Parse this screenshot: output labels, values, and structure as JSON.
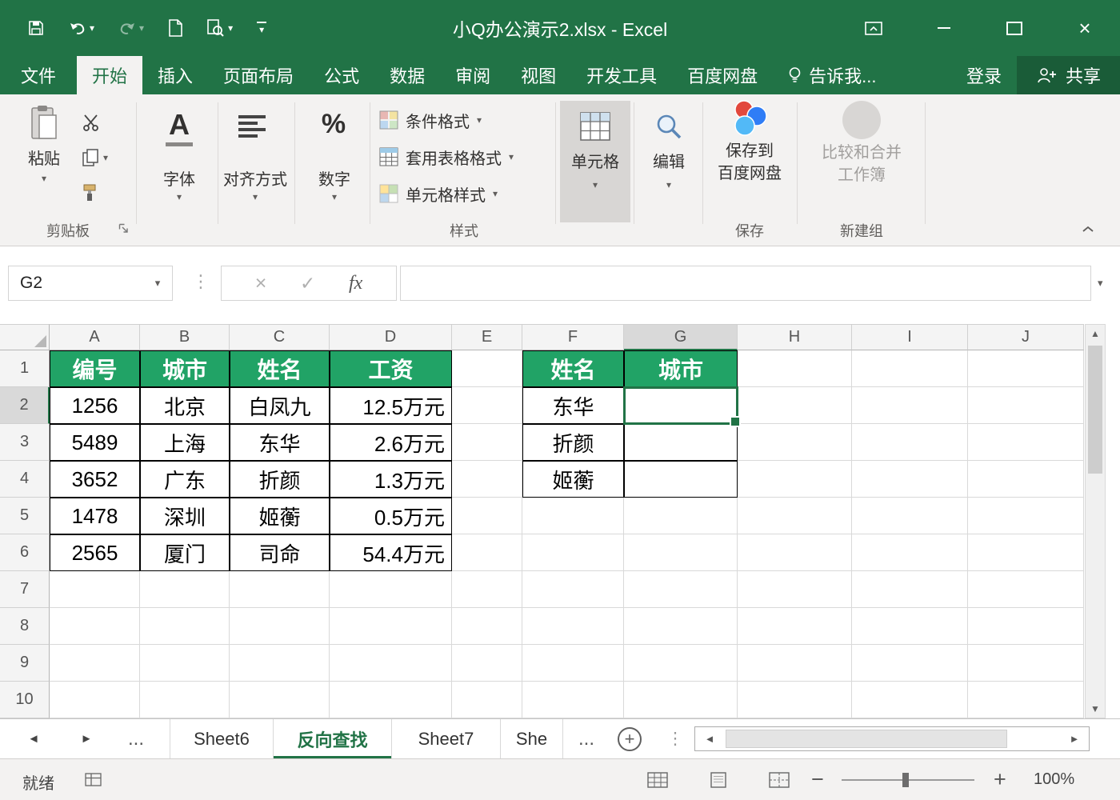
{
  "colors": {
    "excel_green": "#217346",
    "table_header_green": "#21a366",
    "selection_green": "#217346"
  },
  "icons": {
    "caret_down": "▾",
    "ellipsis": "…",
    "vertical_dots": "⋮",
    "left_triangle": "◄",
    "right_triangle": "►",
    "up_triangle": "▲",
    "down_triangle": "▼",
    "close": "×",
    "cancel": "×",
    "check": "✓",
    "plus": "+",
    "minus": "−"
  },
  "title_bar": {
    "title": "小Q办公演示2.xlsx - Excel"
  },
  "ribbon_tabs": {
    "file": "文件",
    "home": "开始",
    "insert": "插入",
    "page_layout": "页面布局",
    "formulas": "公式",
    "data": "数据",
    "review": "审阅",
    "view": "视图",
    "developer": "开发工具",
    "baidu_netdisk": "百度网盘",
    "tell_me": "告诉我...",
    "sign_in": "登录",
    "share": "共享"
  },
  "ribbon": {
    "paste": "粘贴",
    "clipboard_group": "剪贴板",
    "font_label": "字体",
    "font_icon_letter": "A",
    "alignment_label": "对齐方式",
    "number_label": "数字",
    "number_icon": "%",
    "conditional_formatting": "条件格式",
    "format_as_table": "套用表格格式",
    "cell_styles": "单元格样式",
    "styles_group": "样式",
    "cells_button": "单元格",
    "editing_button": "编辑",
    "baidu_save_line1": "保存到",
    "baidu_save_line2": "百度网盘",
    "save_group": "保存",
    "compare_line1": "比较和合并",
    "compare_line2": "工作簿",
    "new_group_label": "新建组"
  },
  "formula_bar": {
    "name_box": "G2",
    "fx_label": "fx",
    "value": ""
  },
  "grid": {
    "col_letters": [
      "A",
      "B",
      "C",
      "D",
      "E",
      "F",
      "G",
      "H",
      "I",
      "J"
    ],
    "row_numbers": [
      "1",
      "2",
      "3",
      "4",
      "5",
      "6",
      "7",
      "8",
      "9",
      "10"
    ],
    "selected_cell": "G2",
    "selected_col": "G",
    "selected_row": "2",
    "cells": [
      {
        "r": 1,
        "c": "A",
        "v": "编号",
        "k": "hdr"
      },
      {
        "r": 1,
        "c": "B",
        "v": "城市",
        "k": "hdr"
      },
      {
        "r": 1,
        "c": "C",
        "v": "姓名",
        "k": "hdr"
      },
      {
        "r": 1,
        "c": "D",
        "v": "工资",
        "k": "hdr"
      },
      {
        "r": 2,
        "c": "A",
        "v": "1256",
        "k": "data"
      },
      {
        "r": 2,
        "c": "B",
        "v": "北京",
        "k": "data"
      },
      {
        "r": 2,
        "c": "C",
        "v": "白凤九",
        "k": "data"
      },
      {
        "r": 2,
        "c": "D",
        "v": "12.5万元",
        "k": "money"
      },
      {
        "r": 3,
        "c": "A",
        "v": "5489",
        "k": "data"
      },
      {
        "r": 3,
        "c": "B",
        "v": "上海",
        "k": "data"
      },
      {
        "r": 3,
        "c": "C",
        "v": "东华",
        "k": "data"
      },
      {
        "r": 3,
        "c": "D",
        "v": "2.6万元",
        "k": "money"
      },
      {
        "r": 4,
        "c": "A",
        "v": "3652",
        "k": "data"
      },
      {
        "r": 4,
        "c": "B",
        "v": "广东",
        "k": "data"
      },
      {
        "r": 4,
        "c": "C",
        "v": "折颜",
        "k": "data"
      },
      {
        "r": 4,
        "c": "D",
        "v": "1.3万元",
        "k": "money"
      },
      {
        "r": 5,
        "c": "A",
        "v": "1478",
        "k": "data"
      },
      {
        "r": 5,
        "c": "B",
        "v": "深圳",
        "k": "data"
      },
      {
        "r": 5,
        "c": "C",
        "v": "姬蘅",
        "k": "data"
      },
      {
        "r": 5,
        "c": "D",
        "v": "0.5万元",
        "k": "money"
      },
      {
        "r": 6,
        "c": "A",
        "v": "2565",
        "k": "data"
      },
      {
        "r": 6,
        "c": "B",
        "v": "厦门",
        "k": "data"
      },
      {
        "r": 6,
        "c": "C",
        "v": "司命",
        "k": "data"
      },
      {
        "r": 6,
        "c": "D",
        "v": "54.4万元",
        "k": "money"
      },
      {
        "r": 1,
        "c": "F",
        "v": "姓名",
        "k": "hdr"
      },
      {
        "r": 1,
        "c": "G",
        "v": "城市",
        "k": "hdr"
      },
      {
        "r": 2,
        "c": "F",
        "v": "东华",
        "k": "data"
      },
      {
        "r": 2,
        "c": "G",
        "v": "",
        "k": "selected"
      },
      {
        "r": 3,
        "c": "F",
        "v": "折颜",
        "k": "data"
      },
      {
        "r": 3,
        "c": "G",
        "v": "",
        "k": "data"
      },
      {
        "r": 4,
        "c": "F",
        "v": "姬蘅",
        "k": "data"
      },
      {
        "r": 4,
        "c": "G",
        "v": "",
        "k": "data"
      }
    ]
  },
  "sheet_tabs": {
    "overflow_left": "...",
    "tabs": [
      "Sheet6",
      "反向查找",
      "Sheet7",
      "She"
    ],
    "active": "反向查找",
    "overflow_right": "..."
  },
  "status_bar": {
    "ready": "就绪",
    "zoom_level": "100%"
  }
}
